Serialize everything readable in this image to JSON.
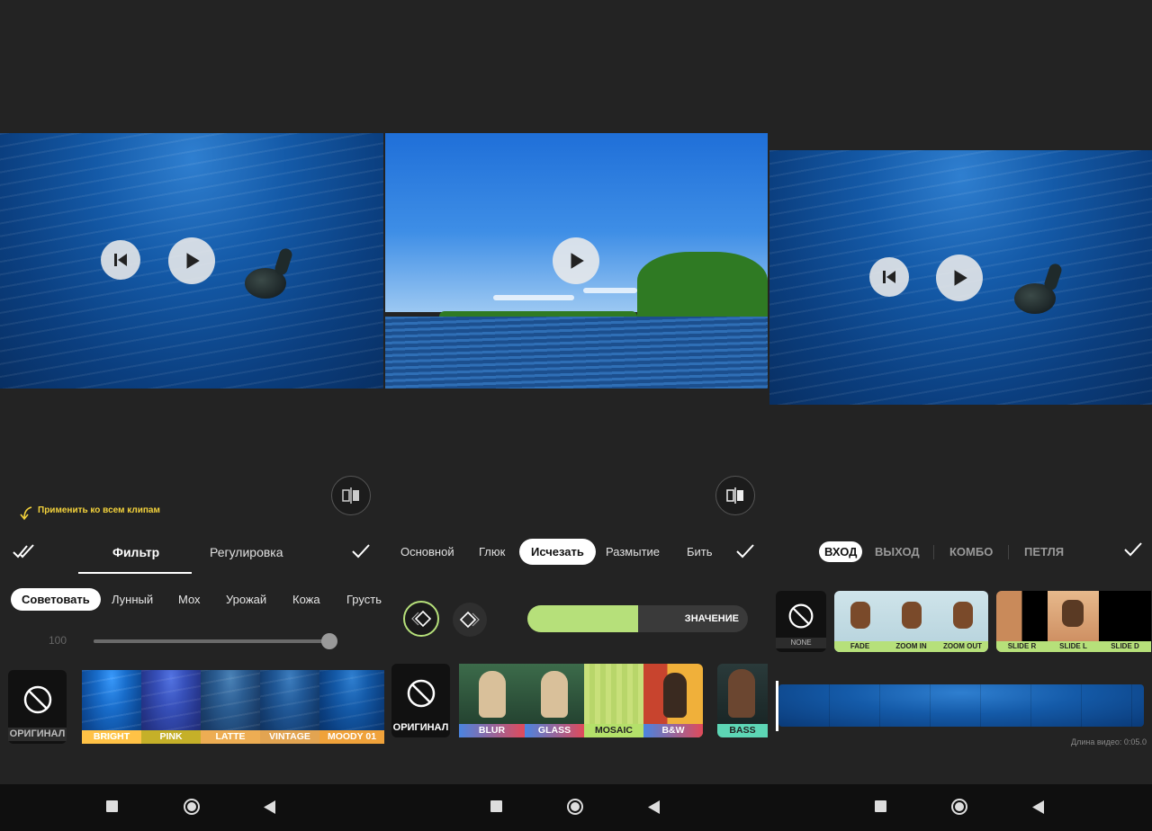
{
  "panels": {
    "left": {
      "apply_all_label": "Применить ко всем клипам",
      "tabs": [
        "Фильтр",
        "Регулировка"
      ],
      "selected_tab": "Фильтр",
      "categories": [
        "Советовать",
        "Лунный",
        "Мох",
        "Урожай",
        "Кожа",
        "Грусть"
      ],
      "selected_category": "Советовать",
      "intensity_value": "100",
      "intensity_fraction": 1.0,
      "original_label": "ОРИГИНАЛ",
      "filters": [
        {
          "label": "BRIGHT",
          "color": "#f0a23a"
        },
        {
          "label": "PINK",
          "color": "#f0a23a"
        },
        {
          "label": "LATTE",
          "color": "#f0a23a"
        },
        {
          "label": "VINTAGE",
          "color": "#f0a23a"
        },
        {
          "label": "MOODY 01",
          "color": "#f0a23a"
        }
      ]
    },
    "middle": {
      "tabs": [
        "Основной",
        "Глюк",
        "Исчезать",
        "Размытие",
        "Бить"
      ],
      "selected_tab": "Исчезать",
      "value_label": "ЗНАЧЕНИЕ",
      "value_fraction": 0.5,
      "original_label": "ОРИГИНАЛ",
      "effects": [
        {
          "label": "BLUR",
          "color": "#e04a5a"
        },
        {
          "label": "GLASS",
          "color": "#e04a5a"
        },
        {
          "label": "MOSAIC",
          "color": "#b4e06a"
        },
        {
          "label": "B&W",
          "color": "#e04a5a"
        },
        {
          "label": "BASS",
          "color": "#5dd6b5"
        }
      ]
    },
    "right": {
      "tabs": [
        "ВХОД",
        "ВЫХОД",
        "КОМБО",
        "ПЕТЛЯ"
      ],
      "selected_tab": "ВХОД",
      "none_label": "NONE",
      "animations": [
        "FADE",
        "ZOOM IN",
        "ZOOM OUT"
      ],
      "slides": [
        "SLIDE R",
        "SLIDE L",
        "SLIDE D"
      ],
      "duration_label": "Длина видео: 0:05.0"
    }
  },
  "colors": {
    "accent_yellow": "#f3d23c",
    "accent_green": "#b6e07a",
    "orange_label": "#f0a23a"
  },
  "icons": {
    "play": "play-icon",
    "prev": "skip-back-icon",
    "compare": "compare-icon",
    "confirm": "check-icon",
    "none": "prohibited-icon"
  }
}
